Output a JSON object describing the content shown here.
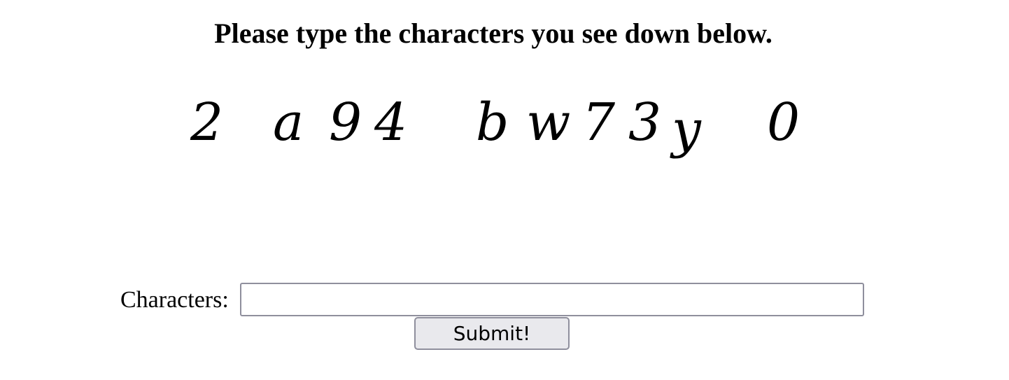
{
  "instruction": "Please type the characters you see down below.",
  "captcha": {
    "characters": [
      "2",
      "a",
      "9",
      "4",
      "b",
      "w",
      "7",
      "3",
      "y",
      "0"
    ]
  },
  "form": {
    "label": "Characters:",
    "input_value": "",
    "input_placeholder": "",
    "submit_label": "Submit!"
  }
}
